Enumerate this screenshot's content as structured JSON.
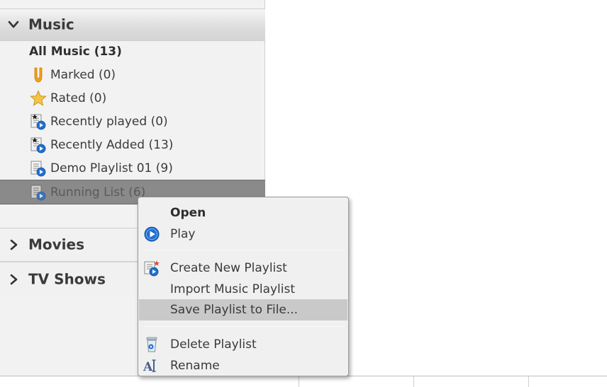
{
  "sidebar": {
    "music": {
      "title": "Music",
      "items": [
        {
          "label": "All Music (13)"
        },
        {
          "label": "Marked (0)",
          "icon": "marked-flag-icon"
        },
        {
          "label": "Rated (0)",
          "icon": "star-icon"
        },
        {
          "label": "Recently played (0)",
          "icon": "smart-playlist-icon"
        },
        {
          "label": "Recently Added (13)",
          "icon": "smart-playlist-icon"
        },
        {
          "label": "Demo Playlist 01 (9)",
          "icon": "playlist-icon"
        },
        {
          "label": "Running List (6)",
          "icon": "playlist-icon"
        }
      ]
    },
    "movies": {
      "title": "Movies"
    },
    "tv_shows": {
      "title": "TV Shows"
    }
  },
  "context_menu": {
    "items": [
      {
        "label": "Open"
      },
      {
        "label": "Play",
        "icon": "play-icon"
      },
      {
        "label": "Create New Playlist",
        "icon": "new-playlist-icon"
      },
      {
        "label": "Import Music Playlist"
      },
      {
        "label": "Save Playlist to File..."
      },
      {
        "label": "Delete Playlist",
        "icon": "delete-playlist-icon"
      },
      {
        "label": "Rename",
        "icon": "rename-icon"
      }
    ]
  },
  "colors": {
    "selection": "#8a8a8a",
    "menu_highlight": "#c9c9c9",
    "play_blue": "#1e6fd0",
    "star_yellow": "#f5c542",
    "flag_orange": "#f0a21a"
  }
}
